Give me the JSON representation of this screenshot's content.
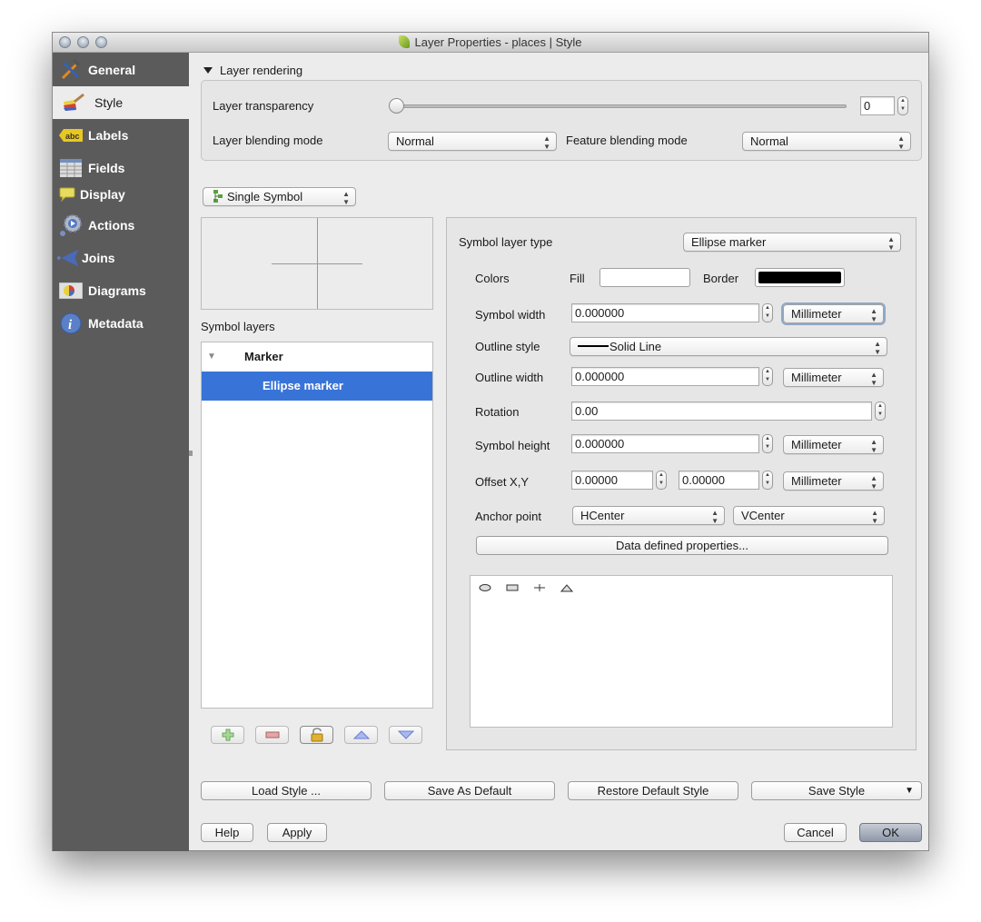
{
  "window": {
    "title": "Layer Properties - places | Style"
  },
  "sidebar": {
    "items": [
      {
        "label": "General",
        "icon": "hammer-screwdriver-icon",
        "active": false
      },
      {
        "label": "Style",
        "icon": "paintbrush-icon",
        "active": true
      },
      {
        "label": "Labels",
        "icon": "abc-label-icon",
        "active": false
      },
      {
        "label": "Fields",
        "icon": "table-icon",
        "active": false
      },
      {
        "label": "Display",
        "icon": "speech-bubble-icon",
        "active": false
      },
      {
        "label": "Actions",
        "icon": "gear-play-icon",
        "active": false
      },
      {
        "label": "Joins",
        "icon": "join-arrow-icon",
        "active": false
      },
      {
        "label": "Diagrams",
        "icon": "pie-diagram-icon",
        "active": false
      },
      {
        "label": "Metadata",
        "icon": "info-icon",
        "active": false
      }
    ]
  },
  "layer_rendering": {
    "title": "Layer rendering",
    "transparency_label": "Layer transparency",
    "transparency_value": "0",
    "transparency_fraction": 0,
    "blending_label": "Layer blending mode",
    "blending_value": "Normal",
    "feature_blending_label": "Feature blending mode",
    "feature_blending_value": "Normal"
  },
  "renderer": {
    "type_value": "Single Symbol"
  },
  "symbol_layers": {
    "label": "Symbol layers",
    "tree": [
      {
        "label": "Marker",
        "level": 0,
        "selected": false
      },
      {
        "label": "Ellipse marker",
        "level": 1,
        "selected": true
      }
    ]
  },
  "properties": {
    "symbol_layer_type_label": "Symbol layer type",
    "symbol_layer_type_value": "Ellipse marker",
    "colors_label": "Colors",
    "fill_label": "Fill",
    "fill_color": "#ffffff",
    "border_label": "Border",
    "border_color": "#000000",
    "symbol_width_label": "Symbol width",
    "symbol_width_value": "0.000000",
    "symbol_width_unit": "Millimeter",
    "outline_style_label": "Outline style",
    "outline_style_value": "Solid Line",
    "outline_width_label": "Outline width",
    "outline_width_value": "0.000000",
    "outline_width_unit": "Millimeter",
    "rotation_label": "Rotation",
    "rotation_value": "0.00",
    "symbol_height_label": "Symbol height",
    "symbol_height_value": "0.000000",
    "symbol_height_unit": "Millimeter",
    "offset_label": "Offset X,Y",
    "offset_x_value": "0.00000",
    "offset_y_value": "0.00000",
    "offset_unit": "Millimeter",
    "anchor_label": "Anchor point",
    "anchor_h_value": "HCenter",
    "anchor_v_value": "VCenter",
    "data_defined_label": "Data defined properties...",
    "shapes": [
      "circle",
      "rectangle",
      "cross",
      "triangle"
    ]
  },
  "style_buttons": {
    "load": "Load Style ...",
    "save_default": "Save As Default",
    "restore_default": "Restore Default Style",
    "save_style": "Save Style"
  },
  "dialog_buttons": {
    "help": "Help",
    "apply": "Apply",
    "cancel": "Cancel",
    "ok": "OK"
  }
}
